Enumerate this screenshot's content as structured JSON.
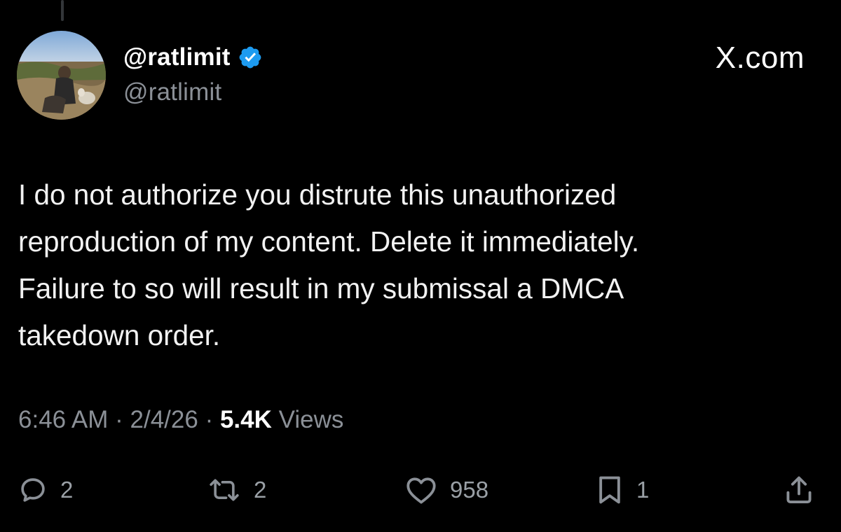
{
  "header": {
    "display_name": "@ratlimit",
    "handle": "@ratlimit",
    "brand": "X.com"
  },
  "tweet": {
    "text": "I do not authorize you distrute this unauthorized\nreproduction of my content. Delete it immediately.\nFailure to so will result in my submissal a DMCA\ntakedown order."
  },
  "meta": {
    "time": "6:46 AM",
    "separator": " · ",
    "date": "2/4/26",
    "views_count": "5.4K",
    "views_label": " Views"
  },
  "actions": {
    "replies": "2",
    "reposts": "2",
    "likes": "958",
    "bookmarks": "1"
  },
  "icons": {
    "verified": "verified-badge-icon",
    "reply": "reply-bubble-icon",
    "repost": "repost-icon",
    "like": "heart-icon",
    "bookmark": "bookmark-icon",
    "share": "share-icon"
  },
  "colors": {
    "background": "#000000",
    "verified_blue": "#1d9bf0",
    "muted": "#8b9097",
    "text": "#f2f2f2"
  }
}
